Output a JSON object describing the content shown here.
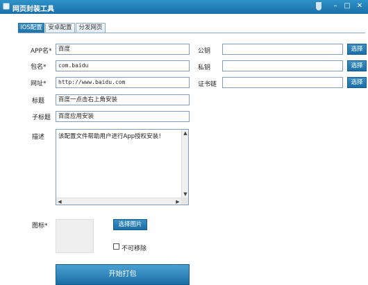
{
  "window": {
    "title": "网页封装工具",
    "minimize": "–",
    "maximize": "□",
    "close": "✕"
  },
  "tabs": [
    {
      "label": "IOS配置",
      "active": true
    },
    {
      "label": "安卓配置",
      "active": false
    },
    {
      "label": "分发网页",
      "active": false
    }
  ],
  "form": {
    "app_name": {
      "label": "APP名*",
      "value": "百度"
    },
    "package_name": {
      "label": "包名*",
      "value": "com.baidu"
    },
    "url": {
      "label": "网址*",
      "value": "http://www.baidu.com"
    },
    "title": {
      "label": "标题",
      "value": "百度一点击右上角安装"
    },
    "subtitle": {
      "label": "子标题",
      "value": "百度应用安装"
    },
    "description": {
      "label": "描述",
      "value": "该配置文件帮助用户进行App授权安装！"
    },
    "public_key": {
      "label": "公钥",
      "value": ""
    },
    "private_key": {
      "label": "私钥",
      "value": ""
    },
    "certificate_chain": {
      "label": "证书链",
      "value": ""
    },
    "select_label": "选择",
    "icon": {
      "label": "图标*",
      "choose_label": "选择图片"
    },
    "non_removable": {
      "label": "不可移除",
      "checked": false
    },
    "pack_button": "开始打包"
  },
  "colors": {
    "title_bar": "#1b6fa6",
    "button": "#1f76ad",
    "field_border": "#7f9db9"
  }
}
